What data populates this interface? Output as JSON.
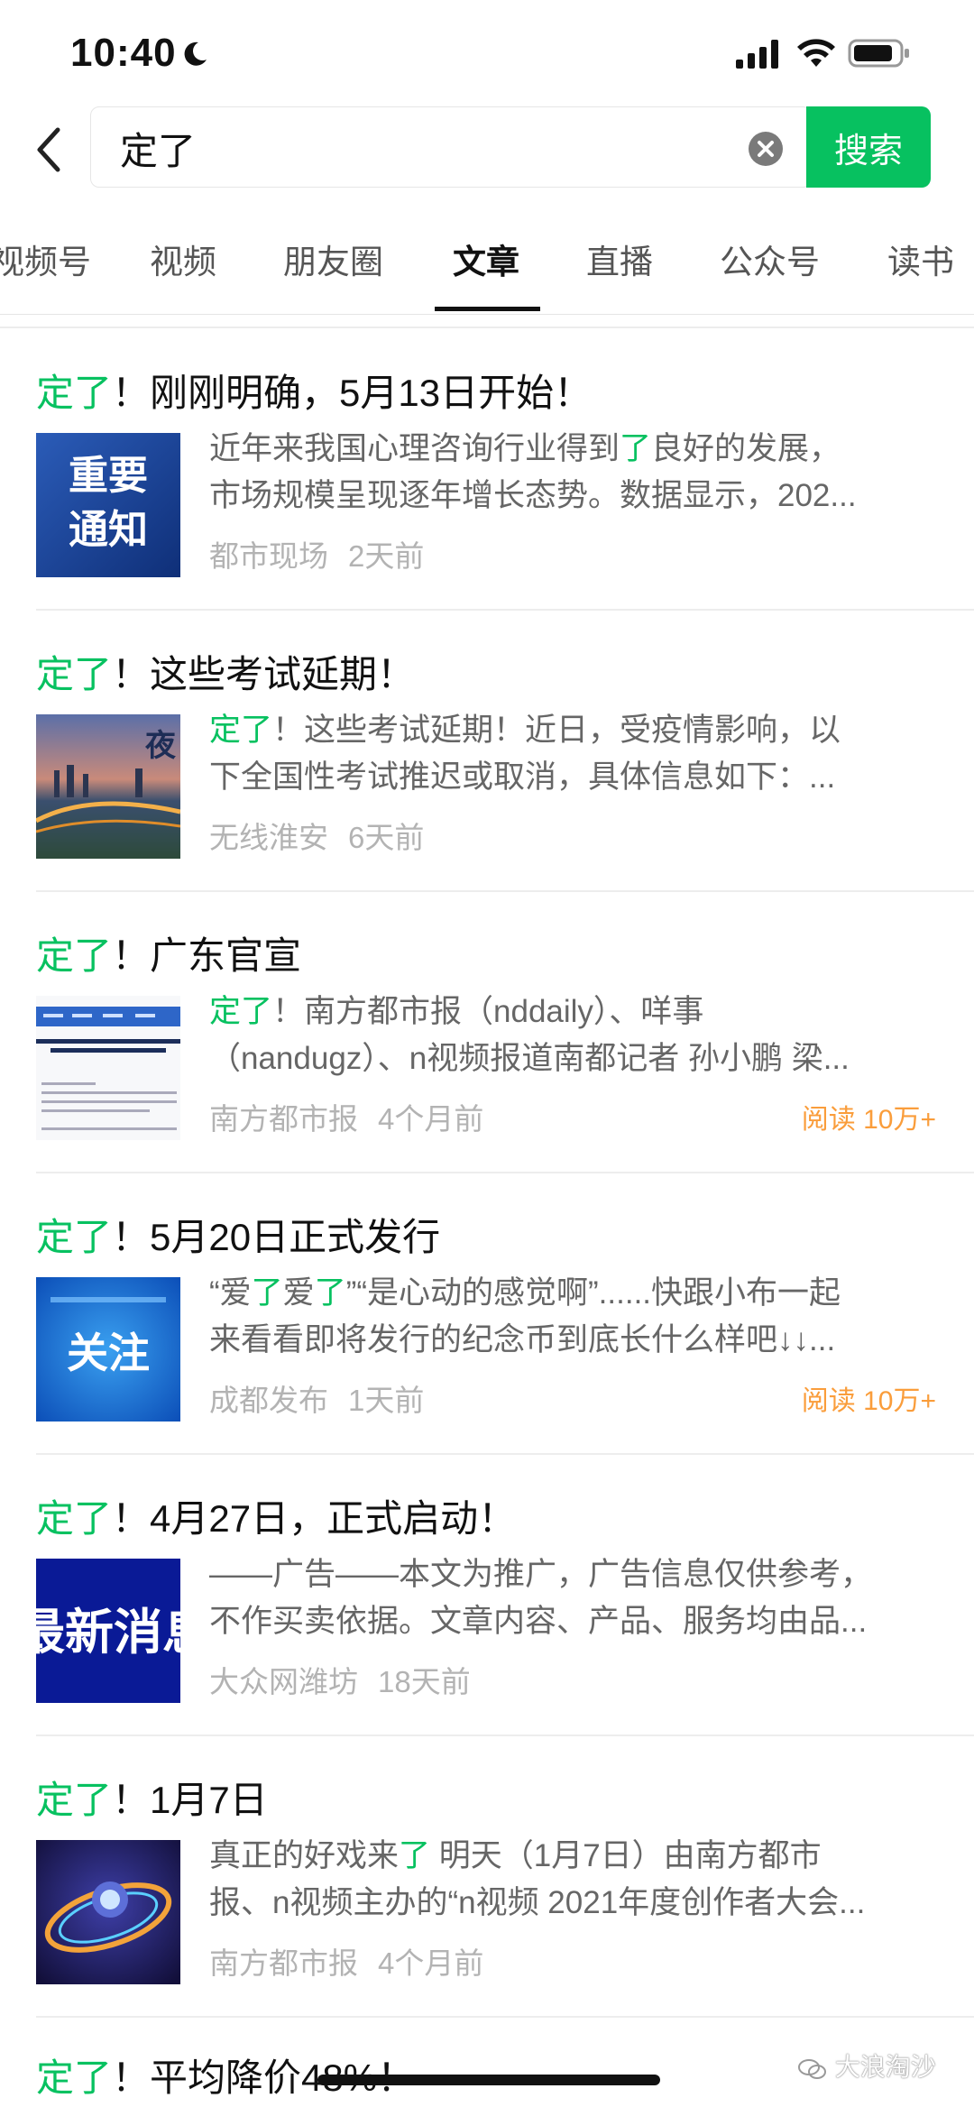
{
  "status_bar": {
    "time": "10:40"
  },
  "search": {
    "query": "定了",
    "button_label": "搜索"
  },
  "tabs": [
    {
      "label": "视频号",
      "active": false
    },
    {
      "label": "视频",
      "active": false
    },
    {
      "label": "朋友圈",
      "active": false
    },
    {
      "label": "文章",
      "active": true
    },
    {
      "label": "直播",
      "active": false
    },
    {
      "label": "公众号",
      "active": false
    },
    {
      "label": "读书",
      "active": false
    }
  ],
  "results": [
    {
      "title_hl": "定了",
      "title_rest": "！刚刚明确，5月13日开始！",
      "desc_line1": [
        {
          "t": "近年来我国心理咨询行业得到",
          "hl": false
        },
        {
          "t": "了",
          "hl": true
        },
        {
          "t": "良好的发展，",
          "hl": false
        }
      ],
      "desc_line2": [
        {
          "t": "市场规模呈现逐年增长态势。数据显示，202...",
          "hl": false
        }
      ],
      "thumb_text": [
        "重要",
        "通知"
      ],
      "source": "都市现场",
      "time": "2天前",
      "reads": ""
    },
    {
      "title_hl": "定了",
      "title_rest": "！这些考试延期！",
      "desc_line1": [
        {
          "t": "定了",
          "hl": true
        },
        {
          "t": "！这些考试延期！近日，受疫情影响，以",
          "hl": false
        }
      ],
      "desc_line2": [
        {
          "t": "下全国性考试推迟或取消，具体信息如下：...",
          "hl": false
        }
      ],
      "thumb_text": [
        "夜"
      ],
      "source": "无线淮安",
      "time": "6天前",
      "reads": ""
    },
    {
      "title_hl": "定了",
      "title_rest": "！广东官宣",
      "desc_line1": [
        {
          "t": "定了",
          "hl": true
        },
        {
          "t": "！南方都市报（nddaily）、咩事",
          "hl": false
        }
      ],
      "desc_line2": [
        {
          "t": "（nandugz）、n视频报道南都记者 孙小鹏 梁...",
          "hl": false
        }
      ],
      "thumb_text": [],
      "source": "南方都市报",
      "time": "4个月前",
      "reads": "阅读 10万+"
    },
    {
      "title_hl": "定了",
      "title_rest": "！5月20日正式发行",
      "desc_line1": [
        {
          "t": "“爱",
          "hl": false
        },
        {
          "t": "了",
          "hl": true
        },
        {
          "t": "爱",
          "hl": false
        },
        {
          "t": "了",
          "hl": true
        },
        {
          "t": "”“是心动的感觉啊”......快跟小布一起",
          "hl": false
        }
      ],
      "desc_line2": [
        {
          "t": "来看看即将发行的纪念币到底长什么样吧↓↓...",
          "hl": false
        }
      ],
      "thumb_text": [
        "关注"
      ],
      "source": "成都发布",
      "time": "1天前",
      "reads": "阅读 10万+"
    },
    {
      "title_hl": "定了",
      "title_rest": "！4月27日，正式启动！",
      "desc_line1": [
        {
          "t": "——广告——本文为推广，广告信息仅供参考，",
          "hl": false
        }
      ],
      "desc_line2": [
        {
          "t": "不作买卖依据。文章内容、产品、服务均由品...",
          "hl": false
        }
      ],
      "thumb_text": [
        "最新消息"
      ],
      "source": "大众网潍坊",
      "time": "18天前",
      "reads": ""
    },
    {
      "title_hl": "定了",
      "title_rest": "！1月7日",
      "desc_line1": [
        {
          "t": "真正的好戏来",
          "hl": false
        },
        {
          "t": "了",
          "hl": true
        },
        {
          "t": " 明天（1月7日）由南方都市",
          "hl": false
        }
      ],
      "desc_line2": [
        {
          "t": "报、n视频主办的“n视频 2021年度创作者大会...",
          "hl": false
        }
      ],
      "thumb_text": [],
      "source": "南方都市报",
      "time": "4个月前",
      "reads": ""
    }
  ],
  "last_item": {
    "title_hl": "定了",
    "title_rest": "！平均降价48%！"
  },
  "watermark": "大浪淘沙",
  "colors": {
    "accent": "#07c160",
    "reads": "#fa9d3b",
    "meta": "#b3b3b3"
  }
}
